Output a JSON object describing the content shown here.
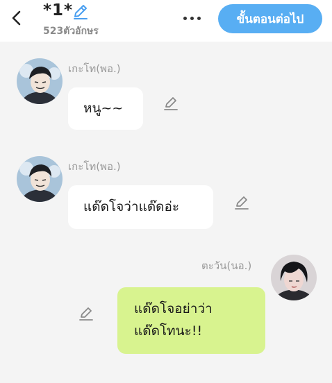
{
  "header": {
    "title": "*1*",
    "char_count": "523ตัวอักษร",
    "next_button": "ขั้นตอนต่อไป",
    "icons": {
      "back": "chevron-left-icon",
      "edit": "pencil-icon",
      "more": "more-horizontal-icon"
    },
    "accent_color": "#58aef3"
  },
  "messages": [
    {
      "sender": "เกะโท(พอ.)",
      "text": "หนู~~",
      "side": "left"
    },
    {
      "sender": "เกะโท(พอ.)",
      "text": "แด๊ดโจว่าแด๊ดอ่ะ",
      "side": "left"
    },
    {
      "sender": "ตะวัน(นอ.)",
      "line1": "แด๊ดโจอย่าว่า",
      "line2": "แด๊ดโทนะ!!",
      "side": "right",
      "bubble_color": "#d8f38f"
    }
  ]
}
